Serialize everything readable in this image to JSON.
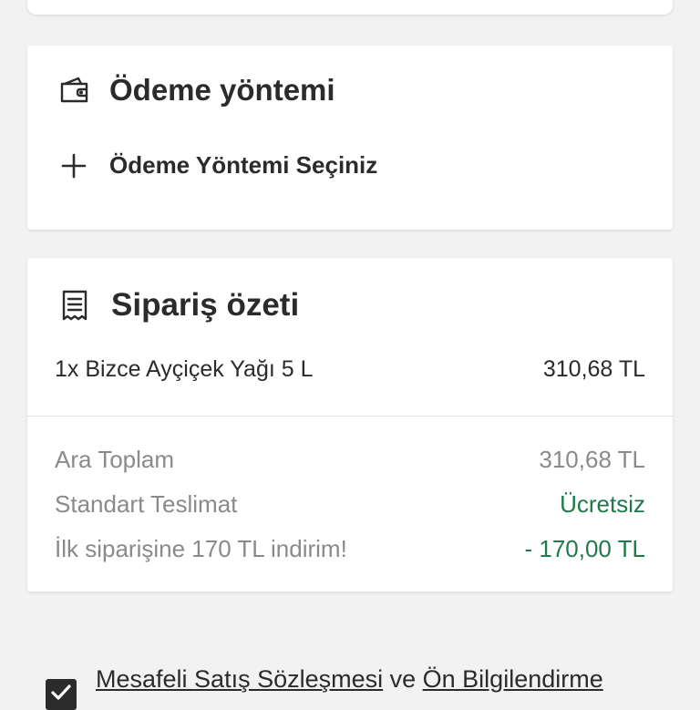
{
  "payment": {
    "title": "Ödeme yöntemi",
    "icon": "wallet-icon",
    "add_label": "Ödeme Yöntemi Seçiniz",
    "add_icon": "plus-icon"
  },
  "summary": {
    "title": "Sipariş özeti",
    "icon": "receipt-icon",
    "item": {
      "name": "1x Bizce Ayçiçek Yağı 5 L",
      "price": "310,68 TL"
    },
    "subtotal": {
      "label": "Ara Toplam",
      "value": "310,68 TL"
    },
    "shipping": {
      "label": "Standart Teslimat",
      "value": "Ücretsiz"
    },
    "discount": {
      "label": "İlk siparişine 170 TL indirim!",
      "value": "- 170,00 TL"
    }
  },
  "agreement": {
    "checked": true,
    "link1": "Mesafeli Satış Sözleşmesi",
    "connector": " ve ",
    "link2": "Ön Bilgilendirme"
  },
  "colors": {
    "accent_green": "#1f7a4a",
    "text_dark": "#2b2b2b",
    "text_muted": "#8a8a8a",
    "background": "#f2f2f2"
  }
}
